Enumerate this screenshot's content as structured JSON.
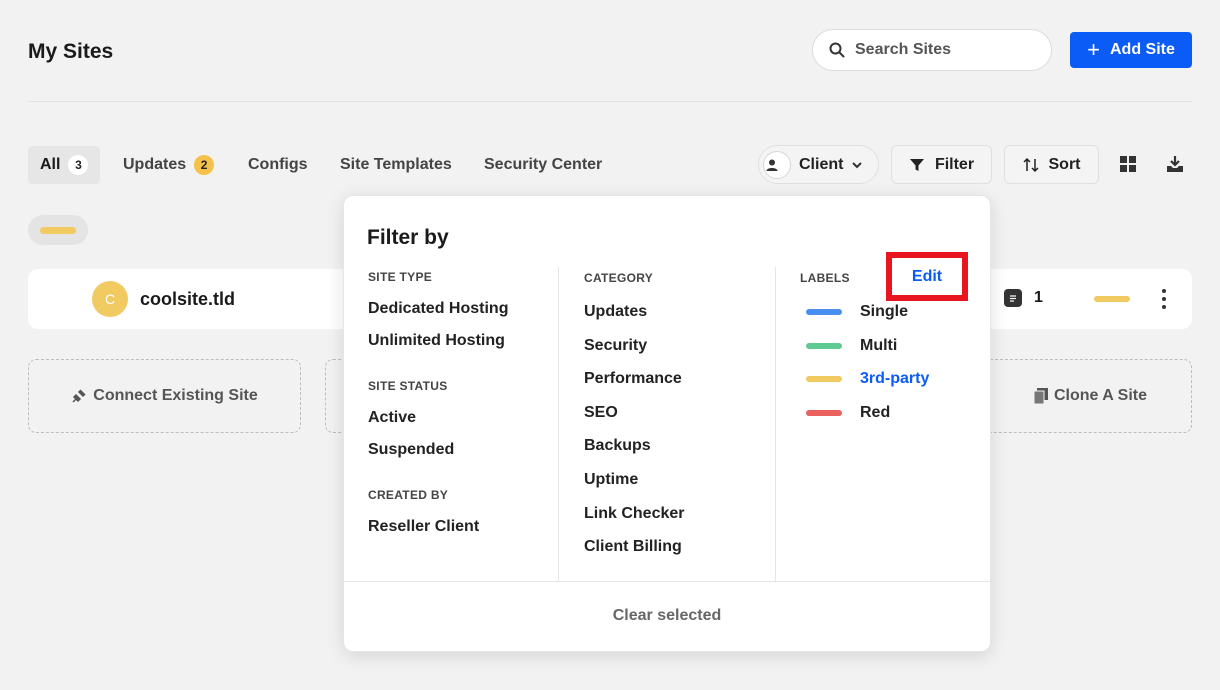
{
  "header": {
    "title": "My Sites",
    "search_placeholder": "Search Sites",
    "add_button": "Add Site"
  },
  "tabs": [
    {
      "label": "All",
      "count": "3",
      "active": true
    },
    {
      "label": "Updates",
      "count": "2",
      "active": false
    },
    {
      "label": "Configs"
    },
    {
      "label": "Site Templates"
    },
    {
      "label": "Security Center"
    }
  ],
  "toolbar": {
    "client": "Client",
    "filter": "Filter",
    "sort": "Sort"
  },
  "site": {
    "avatar_letter": "C",
    "name": "coolsite.tld",
    "count": "1",
    "label_color": "#f2ca62"
  },
  "cards": {
    "connect": "Connect Existing Site",
    "clone": "Clone A Site"
  },
  "filter": {
    "title": "Filter by",
    "site_type": {
      "heading": "SITE TYPE",
      "options": [
        "Dedicated Hosting",
        "Unlimited Hosting"
      ]
    },
    "site_status": {
      "heading": "SITE STATUS",
      "options": [
        "Active",
        "Suspended"
      ]
    },
    "created_by": {
      "heading": "CREATED BY",
      "options": [
        "Reseller Client"
      ]
    },
    "category": {
      "heading": "CATEGORY",
      "options": [
        "Updates",
        "Security",
        "Performance",
        "SEO",
        "Backups",
        "Uptime",
        "Link Checker",
        "Client Billing"
      ]
    },
    "labels": {
      "heading": "LABELS",
      "edit": "Edit",
      "items": [
        {
          "name": "Single",
          "color": "#4a8ef0"
        },
        {
          "name": "Multi",
          "color": "#5fcb93"
        },
        {
          "name": "3rd-party",
          "color": "#f2ca62"
        },
        {
          "name": "Red",
          "color": "#e9605c"
        }
      ]
    },
    "clear": "Clear selected"
  },
  "colors": {
    "accent": "#0b5cf6",
    "highlight_box": "#e8141f"
  }
}
